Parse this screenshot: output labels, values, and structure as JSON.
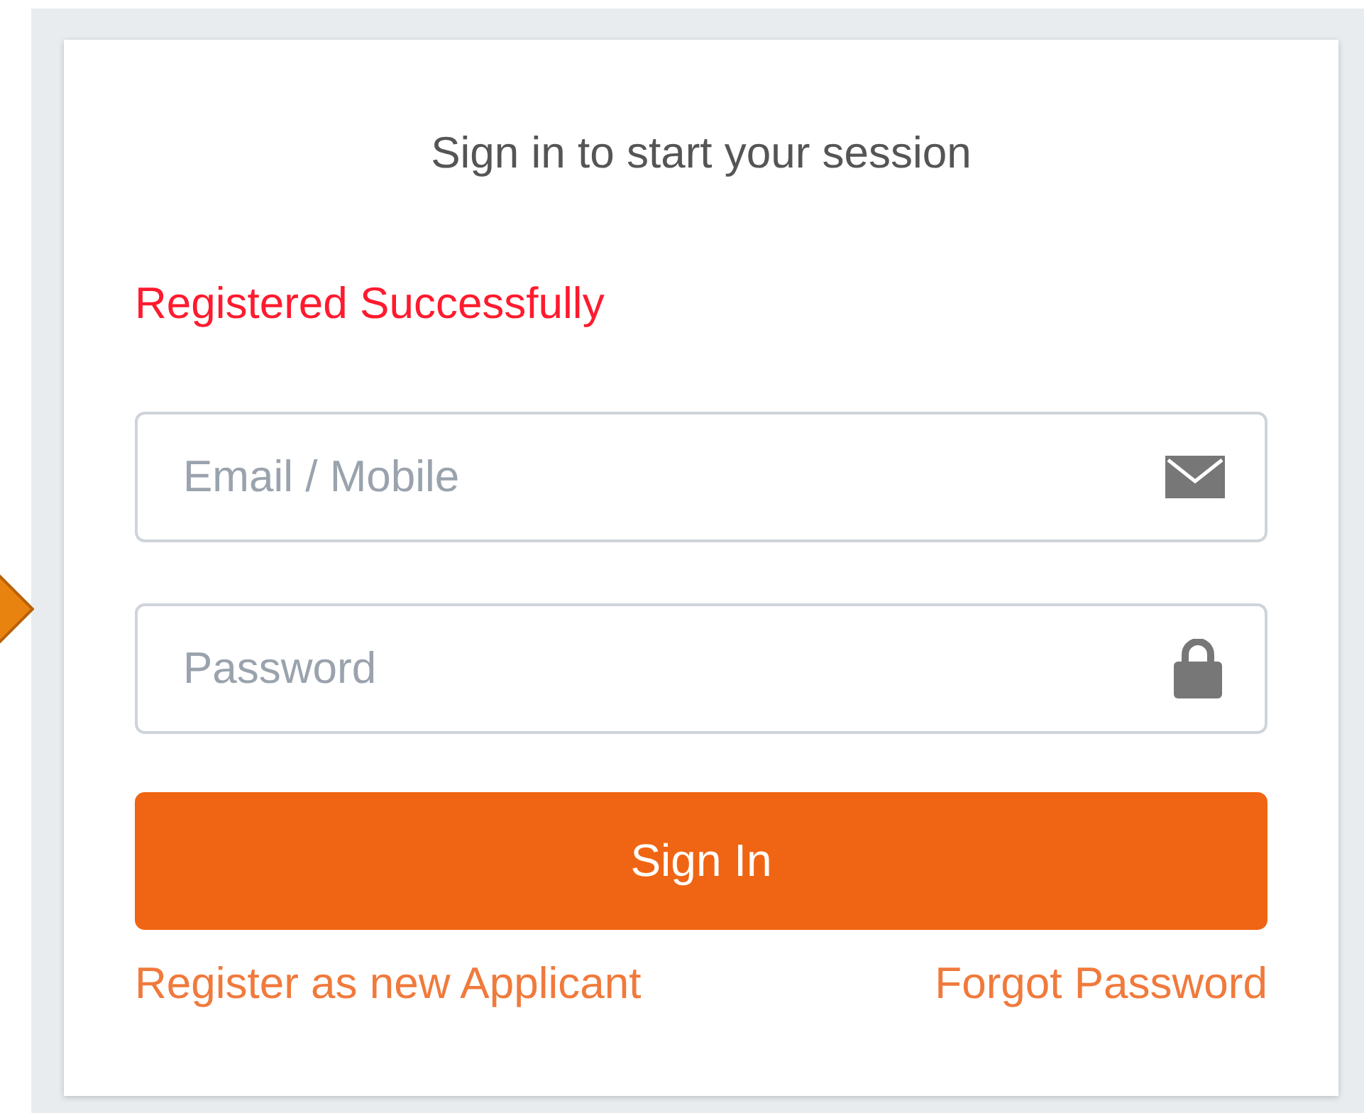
{
  "title": "Sign in to start your session",
  "message": "Registered Successfully",
  "fields": [
    {
      "kind": "email",
      "placeholder": "Email / Mobile"
    },
    {
      "kind": "password",
      "placeholder": "Password"
    }
  ],
  "submit": "Sign In",
  "links": [
    "Register as new Applicant",
    "Forgot Password"
  ]
}
